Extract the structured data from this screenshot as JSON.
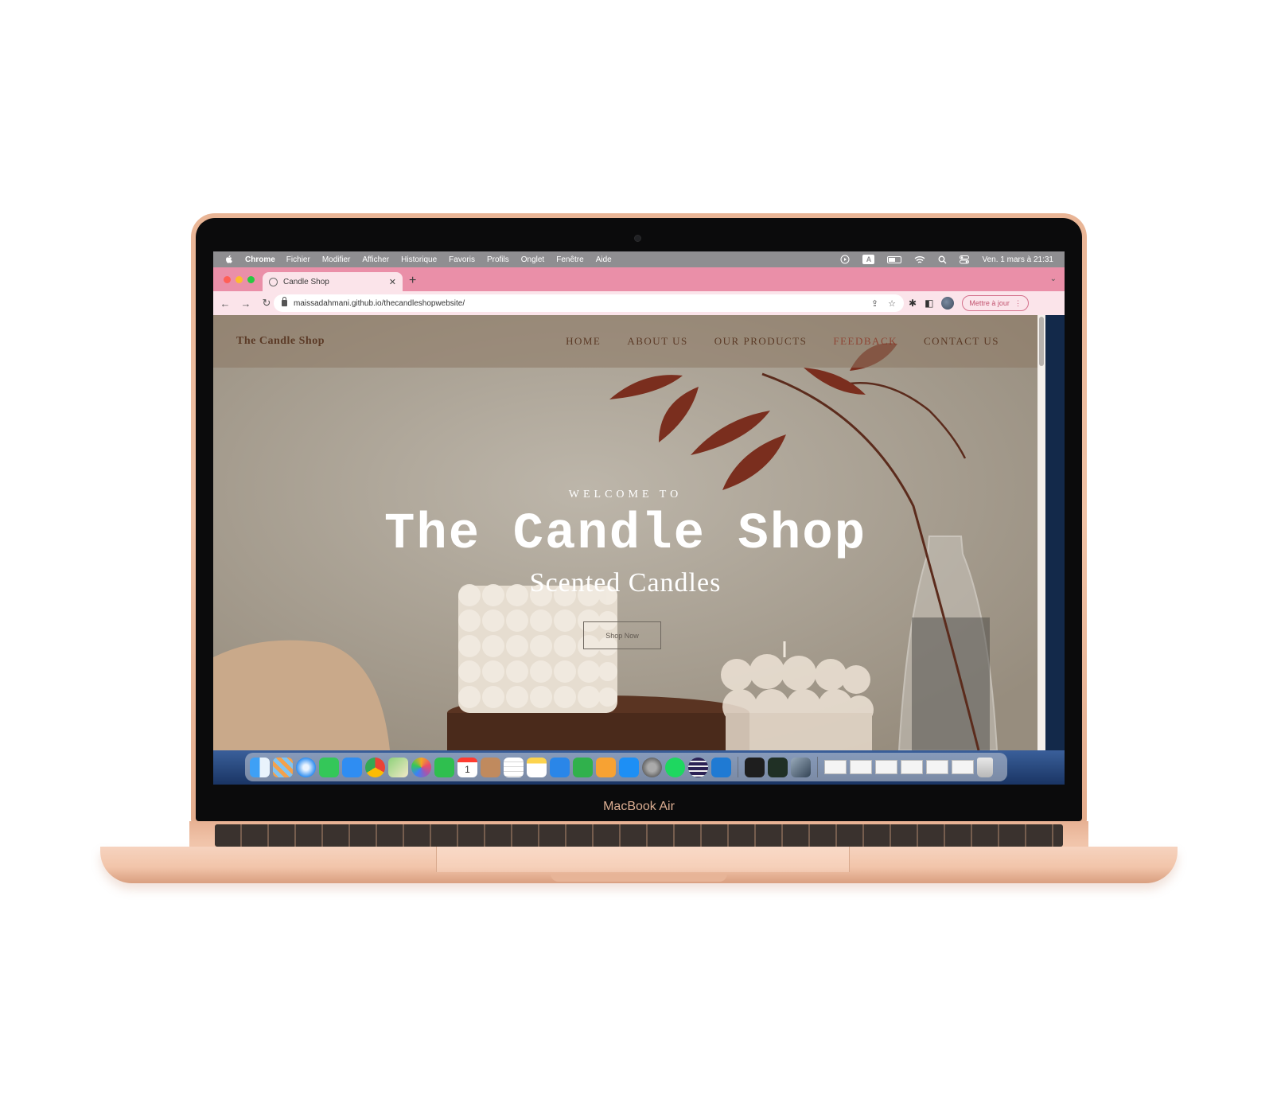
{
  "device": {
    "model_label": "MacBook Air"
  },
  "menubar": {
    "app": "Chrome",
    "items": [
      "Fichier",
      "Modifier",
      "Afficher",
      "Historique",
      "Favoris",
      "Profils",
      "Onglet",
      "Fenêtre",
      "Aide"
    ],
    "status_a": "A",
    "clock": "Ven. 1 mars à 21:31"
  },
  "browser": {
    "tab_title": "Candle Shop",
    "new_tab": "+",
    "url": "maissadahmani.github.io/thecandleshopwebsite/",
    "update_button": "Mettre à jour"
  },
  "site": {
    "brand": "The Candle Shop",
    "nav": [
      "HOME",
      "ABOUT US",
      "OUR PRODUCTS",
      "FEEDBACK",
      "CONTACT US"
    ],
    "hero": {
      "kicker": "WELCOME TO",
      "title": "The Candle Shop",
      "subtitle": "Scented Candles",
      "cta": "Shop Now"
    }
  },
  "colors": {
    "tab_strip": "#ea8fa8",
    "toolbar": "#fbe4ea",
    "laptop_gold": "#f0c2a6",
    "brand_text": "#5b3a26"
  },
  "dock": {
    "icons": [
      "finder-icon",
      "launchpad-icon",
      "safari-icon",
      "messages-icon",
      "mail-icon",
      "chrome-icon",
      "maps-icon",
      "photos-icon",
      "facetime-icon",
      "calendar-icon",
      "contacts-icon",
      "reminders-icon",
      "notes-icon",
      "keynote-icon",
      "numbers-icon",
      "pages-icon",
      "app-store-icon",
      "system-preferences-icon",
      "spotify-icon",
      "eclipse-icon",
      "vscode-icon",
      "terminal-icon",
      "activity-monitor-icon",
      "preview-icon",
      "trash-icon"
    ],
    "calendar_day": "1"
  }
}
